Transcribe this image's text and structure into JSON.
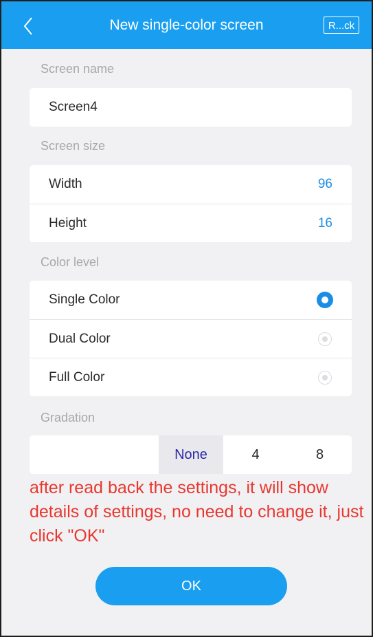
{
  "header": {
    "title": "New single-color screen",
    "right_button_label": "R...ck",
    "back_icon": "chevron-left-icon"
  },
  "screen_name": {
    "label": "Screen name",
    "value": "Screen4"
  },
  "screen_size": {
    "label": "Screen size",
    "width_label": "Width",
    "width_value": "96",
    "height_label": "Height",
    "height_value": "16"
  },
  "color_level": {
    "label": "Color level",
    "options": [
      {
        "label": "Single Color",
        "selected": true
      },
      {
        "label": "Dual Color",
        "selected": false
      },
      {
        "label": "Full Color",
        "selected": false
      }
    ]
  },
  "gradation": {
    "label": "Gradation",
    "options": [
      "None",
      "4",
      "8"
    ],
    "selected": "None"
  },
  "annotation": "after read back the settings, it will show details of settings, no need to change it, just click \"OK\"",
  "ok_label": "OK",
  "colors": {
    "accent": "#1a9ff0",
    "annotation": "#e8372f"
  }
}
